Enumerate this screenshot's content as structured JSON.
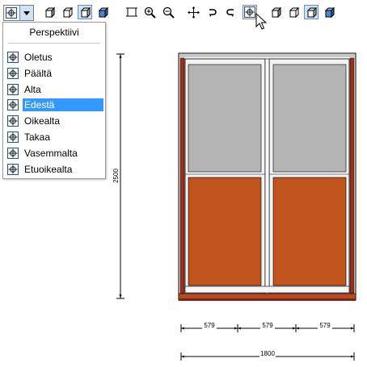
{
  "toolbar": {
    "left_group": [
      "view-dropdown",
      "object-icon",
      "object-icon",
      "object-icon",
      "object-icon"
    ],
    "right_group": [
      "fit-icon",
      "zoom-in-icon",
      "zoom-out-icon",
      "pan-icon",
      "rotate-left-icon",
      "rotate-right-icon",
      "view-icon",
      "object-icon",
      "object-icon",
      "object-icon",
      "object-icon"
    ]
  },
  "view_menu": {
    "header": "Perspektiivi",
    "selected": "Edestä",
    "items": [
      {
        "label": "Oletus"
      },
      {
        "label": "Päältä"
      },
      {
        "label": "Alta"
      },
      {
        "label": "Edestä"
      },
      {
        "label": "Oikealta"
      },
      {
        "label": "Takaa"
      },
      {
        "label": "Vasemmalta"
      },
      {
        "label": "Etuoikealta"
      }
    ]
  },
  "drawing": {
    "height_dim": "2500",
    "section_dims": [
      "579",
      "579",
      "579"
    ],
    "total_width_dim": "1800",
    "colors": {
      "frame": "#8a2a18",
      "glass": "#b4b4b4",
      "wood": "#c0541c",
      "rail": "#f2f2f2"
    }
  }
}
